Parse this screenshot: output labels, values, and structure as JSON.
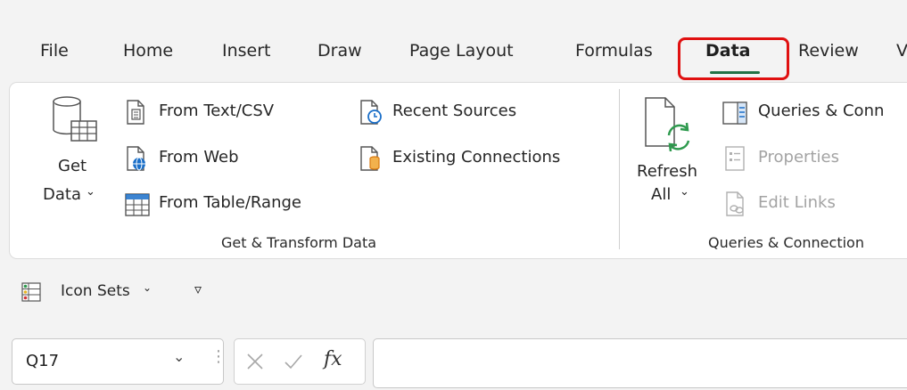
{
  "tabs": {
    "file": "File",
    "home": "Home",
    "insert": "Insert",
    "draw": "Draw",
    "page_layout": "Page Layout",
    "formulas": "Formulas",
    "data": "Data",
    "review": "Review",
    "more": "V"
  },
  "ribbon": {
    "get_transform": {
      "get_data_line1": "Get",
      "get_data_line2": "Data",
      "from_text_csv": "From Text/CSV",
      "from_web": "From Web",
      "from_table_range": "From Table/Range",
      "recent_sources": "Recent Sources",
      "existing_connections": "Existing Connections",
      "group_label": "Get & Transform Data"
    },
    "queries": {
      "refresh_line1": "Refresh",
      "refresh_line2": "All",
      "queries_connections": "Queries & Conn",
      "properties": "Properties",
      "edit_links": "Edit Links",
      "group_label": "Queries & Connection"
    }
  },
  "quick_access": {
    "icon_sets": "Icon Sets"
  },
  "formula_bar": {
    "name_box": "Q17",
    "fx_label": "fx",
    "formula_value": ""
  },
  "colors": {
    "accent_green": "#217346",
    "highlight_red": "#e01010",
    "icon_blue": "#1a6fc9",
    "icon_green": "#2e9a4e",
    "icon_orange": "#d87a12"
  }
}
